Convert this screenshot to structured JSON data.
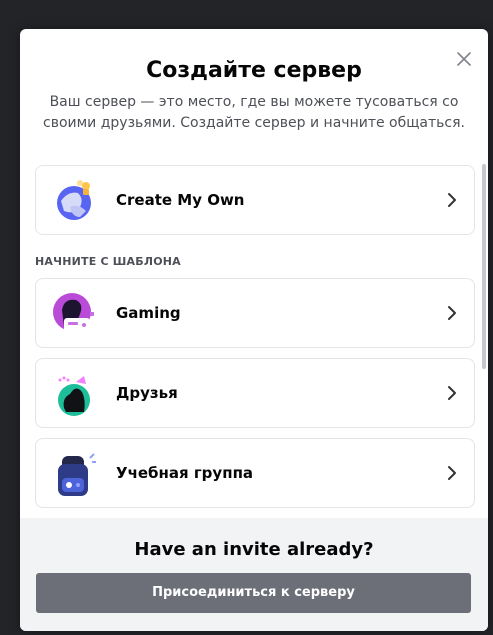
{
  "modal": {
    "title": "Создайте сервер",
    "subtitle": "Ваш сервер — это место, где вы можете тусоваться со своими друзьями. Создайте сервер и начните общаться."
  },
  "options": {
    "create_own": {
      "label": "Create My Own",
      "icon": "globe-icon"
    },
    "section_label": "НАЧНИТЕ С ШАБЛОНА",
    "templates": [
      {
        "label": "Gaming",
        "icon": "gaming-icon"
      },
      {
        "label": "Друзья",
        "icon": "friends-icon"
      },
      {
        "label": "Учебная группа",
        "icon": "backpack-icon"
      }
    ]
  },
  "footer": {
    "title": "Have an invite already?",
    "join_label": "Присоединиться к серверу"
  },
  "colors": {
    "overlay": "#232428",
    "footer_bg": "#f2f3f5",
    "join_button": "#6d6f78",
    "card_border": "#e3e5e8"
  }
}
